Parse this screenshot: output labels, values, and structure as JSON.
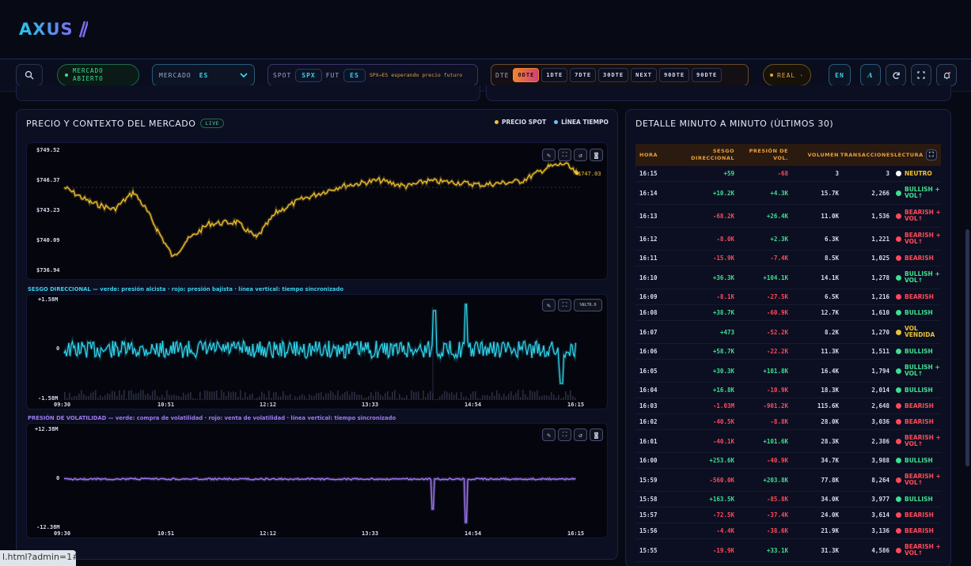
{
  "brand": {
    "logo": "AXUS"
  },
  "toolbar": {
    "market_status": "MERCADO ABIERTO",
    "mercado_label": "MERCADO",
    "mercado_value": "ES",
    "spot_label": "SPOT",
    "spot_value": "SPX",
    "fut_label": "FUT",
    "fut_value": "ES",
    "waiting": "SPX→ES esperando precio futuro",
    "dte_label": "DTE",
    "dte_options": [
      "0DTE",
      "1DTE",
      "7DTE",
      "30DTE",
      "NEXT",
      "90DTE",
      "90DTE"
    ],
    "dte_selected": "0DTE",
    "mode": "REAL",
    "lang": "EN",
    "font_btn": "A"
  },
  "price_panel": {
    "title": "PRECIO Y CONTEXTO DEL MERCADO",
    "live": "LIVE",
    "legend_spot": "PRECIO SPOT",
    "legend_time": "LÍNEA TIEMPO",
    "spot_color": "#f2c12e",
    "time_color": "#6fc3ff",
    "current_price": "$747.03",
    "y_ticks": [
      "$749.52",
      "$746.37",
      "$743.23",
      "$740.09",
      "$736.94"
    ]
  },
  "bias_chart": {
    "label": "SESGO DIRECCIONAL — verde: presión alcista · rojo: presión bajista · línea vertical: tiempo sincronizado",
    "y_ticks": [
      "+1.58M",
      "0",
      "-1.58M"
    ],
    "x_ticks": [
      "09:30",
      "10:51",
      "12:12",
      "13:33",
      "14:54",
      "16:15"
    ],
    "overlay": "%NLTR.0"
  },
  "vol_chart": {
    "label": "PRESIÓN DE VOLATILIDAD — verde: compra de volatilidad · rojo: venta de volatilidad · línea vertical: tiempo sincronizado",
    "y_ticks": [
      "+12.38M",
      "0",
      "-12.38M"
    ],
    "x_ticks": [
      "09:30",
      "10:51",
      "12:12",
      "13:33",
      "14:54",
      "16:15"
    ]
  },
  "detail": {
    "title": "DETALLE MINUTO A MINUTO (ÚLTIMOS 30)",
    "headers": [
      "HORA",
      "SESGO DIRECCIONAL",
      "PRESIÓN DE VOL.",
      "VOLUMEN",
      "TRANSACCIONES",
      "LECTURA"
    ],
    "rows": [
      {
        "hora": "16:15",
        "sesgo": "+59",
        "pres": "-68",
        "vol": "3",
        "tr": "3",
        "lec": "NEUTRO",
        "kind": "neutral"
      },
      {
        "hora": "16:14",
        "sesgo": "+10.2K",
        "pres": "+4.3K",
        "vol": "15.7K",
        "tr": "2,266",
        "lec": "BULLISH + VOL↑",
        "kind": "bull"
      },
      {
        "hora": "16:13",
        "sesgo": "-68.2K",
        "pres": "+26.4K",
        "vol": "11.0K",
        "tr": "1,536",
        "lec": "BEARISH + VOL↑",
        "kind": "bear"
      },
      {
        "hora": "16:12",
        "sesgo": "-8.0K",
        "pres": "+2.3K",
        "vol": "6.3K",
        "tr": "1,221",
        "lec": "BEARISH + VOL↑",
        "kind": "bear"
      },
      {
        "hora": "16:11",
        "sesgo": "-15.9K",
        "pres": "-7.4K",
        "vol": "8.5K",
        "tr": "1,025",
        "lec": "BEARISH",
        "kind": "bear"
      },
      {
        "hora": "16:10",
        "sesgo": "+36.3K",
        "pres": "+104.1K",
        "vol": "14.1K",
        "tr": "1,278",
        "lec": "BULLISH + VOL↑",
        "kind": "bull"
      },
      {
        "hora": "16:09",
        "sesgo": "-8.1K",
        "pres": "-27.5K",
        "vol": "6.5K",
        "tr": "1,216",
        "lec": "BEARISH",
        "kind": "bear"
      },
      {
        "hora": "16:08",
        "sesgo": "+38.7K",
        "pres": "-60.9K",
        "vol": "12.7K",
        "tr": "1,610",
        "lec": "BULLISH",
        "kind": "bull"
      },
      {
        "hora": "16:07",
        "sesgo": "+473",
        "pres": "-52.2K",
        "vol": "8.2K",
        "tr": "1,270",
        "lec": "VOL VENDIDA",
        "kind": "sold"
      },
      {
        "hora": "16:06",
        "sesgo": "+58.7K",
        "pres": "-22.2K",
        "vol": "11.3K",
        "tr": "1,511",
        "lec": "BULLISH",
        "kind": "bull"
      },
      {
        "hora": "16:05",
        "sesgo": "+30.3K",
        "pres": "+101.8K",
        "vol": "16.4K",
        "tr": "1,794",
        "lec": "BULLISH + VOL↑",
        "kind": "bull"
      },
      {
        "hora": "16:04",
        "sesgo": "+16.8K",
        "pres": "-10.9K",
        "vol": "18.3K",
        "tr": "2,014",
        "lec": "BULLISH",
        "kind": "bull"
      },
      {
        "hora": "16:03",
        "sesgo": "-1.03M",
        "pres": "-901.2K",
        "vol": "115.6K",
        "tr": "2,648",
        "lec": "BEARISH",
        "kind": "bear"
      },
      {
        "hora": "16:02",
        "sesgo": "-40.5K",
        "pres": "-8.8K",
        "vol": "28.0K",
        "tr": "3,036",
        "lec": "BEARISH",
        "kind": "bear"
      },
      {
        "hora": "16:01",
        "sesgo": "-40.1K",
        "pres": "+101.6K",
        "vol": "28.3K",
        "tr": "2,386",
        "lec": "BEARISH + VOL↑",
        "kind": "bear"
      },
      {
        "hora": "16:00",
        "sesgo": "+253.6K",
        "pres": "-40.9K",
        "vol": "34.7K",
        "tr": "3,988",
        "lec": "BULLISH",
        "kind": "bull"
      },
      {
        "hora": "15:59",
        "sesgo": "-560.0K",
        "pres": "+203.8K",
        "vol": "77.8K",
        "tr": "8,264",
        "lec": "BEARISH + VOL↑",
        "kind": "bear"
      },
      {
        "hora": "15:58",
        "sesgo": "+163.5K",
        "pres": "-85.8K",
        "vol": "34.0K",
        "tr": "3,977",
        "lec": "BULLISH",
        "kind": "bull"
      },
      {
        "hora": "15:57",
        "sesgo": "-72.5K",
        "pres": "-37.4K",
        "vol": "24.0K",
        "tr": "3,614",
        "lec": "BEARISH",
        "kind": "bear"
      },
      {
        "hora": "15:56",
        "sesgo": "-4.4K",
        "pres": "-38.6K",
        "vol": "21.9K",
        "tr": "3,136",
        "lec": "BEARISH",
        "kind": "bear"
      },
      {
        "hora": "15:55",
        "sesgo": "-19.9K",
        "pres": "+33.1K",
        "vol": "31.3K",
        "tr": "4,586",
        "lec": "BEARISH + VOL↑",
        "kind": "bear"
      }
    ]
  },
  "status_url": "l.html?admin=1#"
}
